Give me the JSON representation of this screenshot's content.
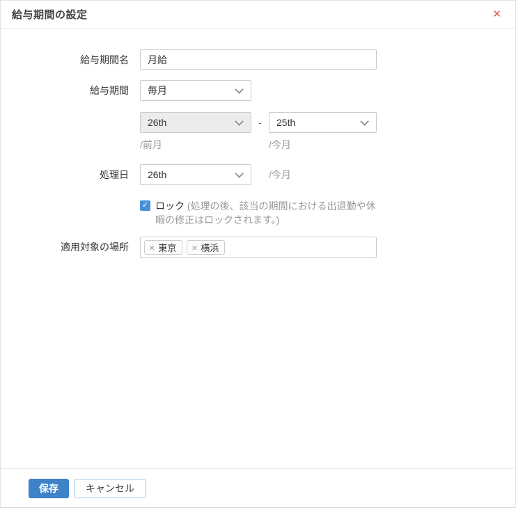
{
  "dialog": {
    "title": "給与期間の設定",
    "close_icon": "✕"
  },
  "form": {
    "period_name": {
      "label": "給与期間名",
      "value": "月給"
    },
    "period": {
      "label": "給与期間",
      "value": "毎月"
    },
    "date_range": {
      "start": {
        "value": "26th",
        "hint": "/前月",
        "disabled": true
      },
      "separator": "-",
      "end": {
        "value": "25th",
        "hint": "/今月"
      }
    },
    "process_day": {
      "label": "処理日",
      "value": "26th",
      "hint": "/今月"
    },
    "lock": {
      "label": "ロック",
      "checked": true,
      "check_icon": "✓",
      "description": "(処理の後、該当の期間における出退勤や休暇の修正はロックされます。)"
    },
    "locations": {
      "label": "適用対象の場所",
      "remove_icon": "×",
      "tags": [
        {
          "text": "東京"
        },
        {
          "text": "横浜"
        }
      ]
    }
  },
  "footer": {
    "save_label": "保存",
    "cancel_label": "キャンセル"
  },
  "colors": {
    "primary_blue": "#3e82c8",
    "checkbox_blue": "#4a90d9",
    "close_red": "#e0584b",
    "cancel_border_blue": "#a6c6e2",
    "muted_text": "#999999",
    "dark_text": "#333333",
    "field_border": "#cccccc",
    "disabled_field_bg": "#ececec"
  }
}
